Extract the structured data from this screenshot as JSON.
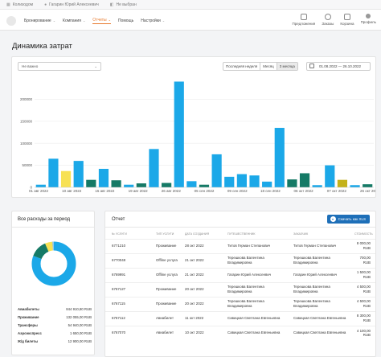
{
  "topbar": [
    {
      "icon": "building-icon",
      "label": "Колизодом"
    },
    {
      "icon": "user-icon",
      "label": "Гагарин Юрий Алексеевич"
    },
    {
      "icon": "cart-icon",
      "label": "Не выбран"
    }
  ],
  "menu": [
    {
      "label": "Бронирование",
      "name": "menu-booking",
      "active": false,
      "chev": true
    },
    {
      "label": "Компания",
      "name": "menu-company",
      "active": false,
      "chev": true
    },
    {
      "label": "Отчеты",
      "name": "menu-reports",
      "active": true,
      "chev": true
    },
    {
      "label": "Помощь",
      "name": "menu-help",
      "active": false,
      "chev": false
    },
    {
      "label": "Настройки",
      "name": "menu-settings",
      "active": false,
      "chev": true
    }
  ],
  "right_nav": [
    {
      "label": "Предложения",
      "icon": "document-icon",
      "kind": "sq"
    },
    {
      "label": "Заказы",
      "icon": "globe-icon",
      "kind": "round"
    },
    {
      "label": "Корзина",
      "icon": "basket-icon",
      "kind": "sq"
    },
    {
      "label": "Профиль",
      "icon": "profile-icon",
      "kind": "dot"
    }
  ],
  "page_title": "Динамика затрат",
  "filter": {
    "value": "Не важно"
  },
  "periods": [
    {
      "label": "Последняя неделя",
      "active": false
    },
    {
      "label": "Месяц",
      "active": false
    },
    {
      "label": "3 месяца",
      "active": true
    }
  ],
  "date_range": "01.08.2022 — 26.10.2022",
  "colors": {
    "blue": "#1ba8e8",
    "teal": "#157a66",
    "yellow": "#f7e154",
    "olive": "#c4b21a",
    "accent": "#e87a2e",
    "button": "#1e6fb8"
  },
  "chart_data": {
    "type": "bar",
    "ylim": [
      0,
      250000
    ],
    "yticks": [
      "0",
      "50000",
      "100000",
      "150000",
      "200000"
    ],
    "xticks": [
      "01 авг 2022",
      "10 авг 2022",
      "15 авг 2022",
      "19 авг 2022",
      "26 авг 2022",
      "05 сен 2022",
      "09 сен 2022",
      "18 сен 2022",
      "06 окт 2022",
      "07 окт 2022",
      "26 окт 2022"
    ],
    "bars": [
      {
        "series": "blue",
        "value": 6000
      },
      {
        "series": "blue",
        "value": 65000
      },
      {
        "series": "yellow",
        "value": 37000
      },
      {
        "series": "blue",
        "value": 60000
      },
      {
        "series": "teal",
        "value": 17000
      },
      {
        "series": "blue",
        "value": 42000
      },
      {
        "series": "teal",
        "value": 16000
      },
      {
        "series": "blue",
        "value": 6000
      },
      {
        "series": "teal",
        "value": 9000
      },
      {
        "series": "blue",
        "value": 87000
      },
      {
        "series": "teal",
        "value": 10000
      },
      {
        "series": "blue",
        "value": 240000
      },
      {
        "series": "blue",
        "value": 14000
      },
      {
        "series": "teal",
        "value": 6000
      },
      {
        "series": "blue",
        "value": 75000
      },
      {
        "series": "blue",
        "value": 24000
      },
      {
        "series": "blue",
        "value": 30000
      },
      {
        "series": "blue",
        "value": 27000
      },
      {
        "series": "blue",
        "value": 13000
      },
      {
        "series": "blue",
        "value": 135000
      },
      {
        "series": "teal",
        "value": 18000
      },
      {
        "series": "teal",
        "value": 32000
      },
      {
        "series": "blue",
        "value": 5000
      },
      {
        "series": "blue",
        "value": 50000
      },
      {
        "series": "olive",
        "value": 17000
      },
      {
        "series": "blue",
        "value": 5000
      },
      {
        "series": "teal",
        "value": 7000
      }
    ],
    "donut": [
      {
        "label": "Авиабилеты",
        "value": 844910.8,
        "color": "#1ba8e8"
      },
      {
        "label": "Проживание",
        "value": 132055.0,
        "color": "#157a66"
      },
      {
        "label": "Трансферы",
        "value": 54940.0,
        "color": "#f7e154"
      },
      {
        "label": "Аэроэкспресс",
        "value": 1650.0,
        "color": "#c4b21a"
      },
      {
        "label": "Ж/д билеты",
        "value": 12900.0,
        "color": "#8cc8ee"
      }
    ]
  },
  "summary": {
    "title": "Все расходы за период",
    "rows": [
      {
        "label": "Авиабилеты",
        "amount": "844 910,80 RUB"
      },
      {
        "label": "Проживание",
        "amount": "132 055,00 RUB"
      },
      {
        "label": "Трансферы",
        "amount": "54 940,00 RUB"
      },
      {
        "label": "Аэроэкспресс",
        "amount": "1 650,00 RUB"
      },
      {
        "label": "Ж/д билеты",
        "amount": "12 900,00 RUB"
      }
    ]
  },
  "report": {
    "title": "Отчет",
    "download_label": "Скачать как XLS",
    "headers": [
      "№ услуги",
      "Тип услуги",
      "Дата создания",
      "Путешественник",
      "Заказчик",
      "Стоимость"
    ],
    "rows": [
      [
        "6771210",
        "Проживание",
        "28 окт 2022",
        "Титов Герман Степанович",
        "Титов Герман Степанович",
        "8 000,00 RUB"
      ],
      [
        "6770048",
        "Offline услуга",
        "21 окт 2022",
        "Терешкова Валентина Владимировна",
        "Терешкова Валентина Владимировна",
        "700,00 RUB"
      ],
      [
        "6769991",
        "Offline услуга",
        "21 окт 2022",
        "Гагарин Юрий Алексеевич",
        "Гагарин Юрий Алексеевич",
        "1 500,00 RUB"
      ],
      [
        "6767127",
        "Проживание",
        "20 окт 2022",
        "Терешкова Валентина Владимировна",
        "Терешкова Валентина Владимировна",
        "4 500,00 RUB"
      ],
      [
        "6767115",
        "Проживание",
        "20 окт 2022",
        "Терешкова Валентина Владимировна",
        "Терешкова Валентина Владимировна",
        "4 500,00 RUB"
      ],
      [
        "6767112",
        "Авиабилет",
        "11 окт 2022",
        "Савицкая Светлана Евгеньевна",
        "Савицкая Светлана Евгеньевна",
        "8 300,00 RUB"
      ],
      [
        "6767070",
        "Авиабилет",
        "10 окт 2022",
        "Савицкая Светлана Евгеньевна",
        "Савицкая Светлана Евгеньевна",
        "4 100,00 RUB"
      ]
    ]
  }
}
